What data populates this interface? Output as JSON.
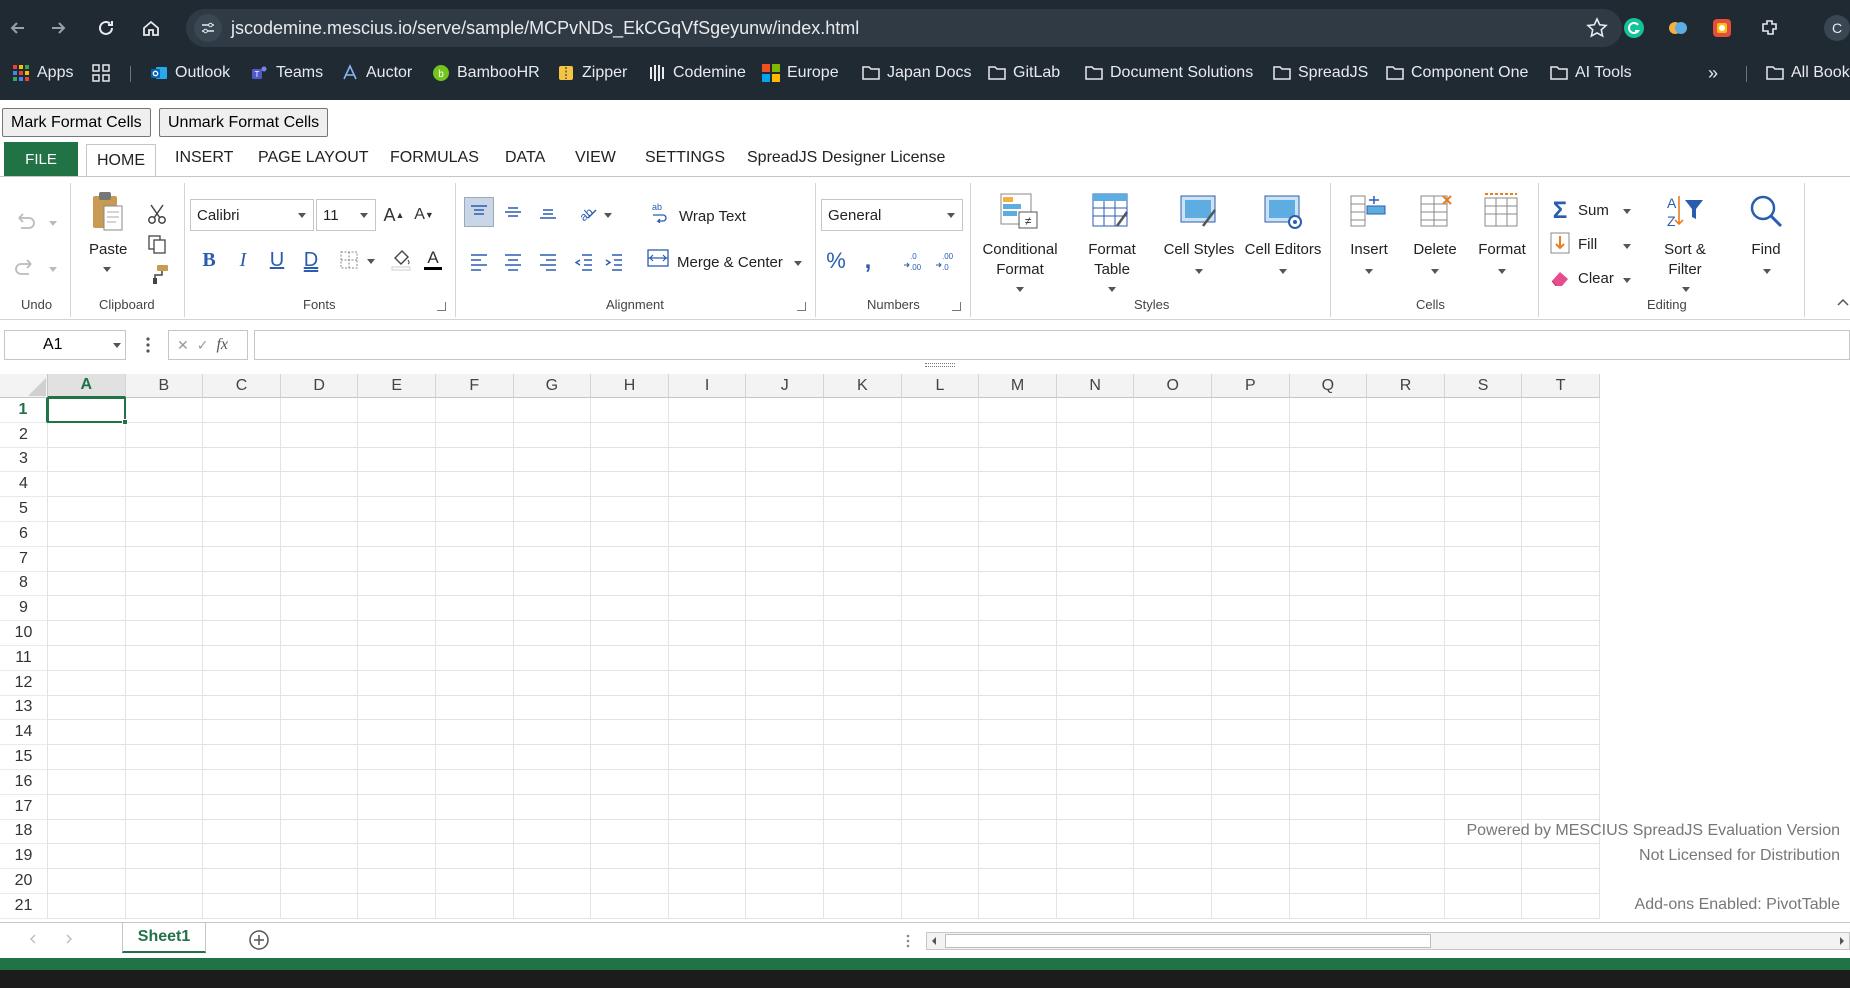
{
  "browser": {
    "url": "jscodemine.mescius.io/serve/sample/MCPvNDs_EkCGqVfSgeyunw/index.html",
    "profile_initial": "C",
    "bookmarks": [
      {
        "label": "Apps",
        "icon": "apps-grid-icon"
      },
      {
        "label": "",
        "icon": "tab-groups-icon"
      },
      {
        "label": "Outlook",
        "icon": "outlook-icon"
      },
      {
        "label": "Teams",
        "icon": "teams-icon"
      },
      {
        "label": "Auctor",
        "icon": "auctor-icon"
      },
      {
        "label": "BambooHR",
        "icon": "bamboohr-icon"
      },
      {
        "label": "Zipper",
        "icon": "zipper-icon"
      },
      {
        "label": "Codemine",
        "icon": "codemine-icon"
      },
      {
        "label": "Europe",
        "icon": "microsoft-icon"
      },
      {
        "label": "Japan Docs",
        "icon": "folder-icon"
      },
      {
        "label": "GitLab",
        "icon": "folder-icon"
      },
      {
        "label": "Document Solutions",
        "icon": "folder-icon"
      },
      {
        "label": "SpreadJS",
        "icon": "folder-icon"
      },
      {
        "label": "Component One",
        "icon": "folder-icon"
      },
      {
        "label": "AI Tools",
        "icon": "folder-icon"
      }
    ],
    "overflow_label": "»",
    "all_bookmarks_label": "All Book"
  },
  "page_buttons": {
    "mark": "Mark Format Cells",
    "unmark": "Unmark Format Cells"
  },
  "ribbon": {
    "tabs": [
      "FILE",
      "HOME",
      "INSERT",
      "PAGE LAYOUT",
      "FORMULAS",
      "DATA",
      "VIEW",
      "SETTINGS",
      "SpreadJS Designer License"
    ],
    "active_tab": "HOME",
    "groups": {
      "undo": "Undo",
      "clipboard": "Clipboard",
      "fonts": "Fonts",
      "alignment": "Alignment",
      "numbers": "Numbers",
      "styles": "Styles",
      "cells": "Cells",
      "editing": "Editing"
    },
    "paste_label": "Paste",
    "font_name": "Calibri",
    "font_size": "11",
    "wrap_text": "Wrap Text",
    "merge_center": "Merge & Center",
    "number_format": "General",
    "conditional_format": [
      "Conditional",
      "Format"
    ],
    "format_table": [
      "Format",
      "Table"
    ],
    "cell_styles": "Cell Styles",
    "cell_editors": "Cell Editors",
    "insert": "Insert",
    "delete": "Delete",
    "format": "Format",
    "sum": "Sum",
    "fill": "Fill",
    "clear": "Clear",
    "sort_filter": [
      "Sort &",
      "Filter"
    ],
    "find": "Find"
  },
  "formula_bar": {
    "name_box": "A1",
    "fx": "fx",
    "formula": ""
  },
  "grid": {
    "columns": [
      "A",
      "B",
      "C",
      "D",
      "E",
      "F",
      "G",
      "H",
      "I",
      "J",
      "K",
      "L",
      "M",
      "N",
      "O",
      "P",
      "Q",
      "R",
      "S",
      "T"
    ],
    "rows": [
      "1",
      "2",
      "3",
      "4",
      "5",
      "6",
      "7",
      "8",
      "9",
      "10",
      "11",
      "12",
      "13",
      "14",
      "15",
      "16",
      "17",
      "18",
      "19",
      "20",
      "21"
    ],
    "active_cell": "A1",
    "watermark": [
      "Powered by MESCIUS SpreadJS Evaluation Version",
      "Not Licensed for Distribution",
      "Add-ons Enabled: PivotTable"
    ]
  },
  "sheets": [
    "Sheet1"
  ],
  "colors": {
    "accent": "#217346",
    "chrome": "#202a33"
  }
}
